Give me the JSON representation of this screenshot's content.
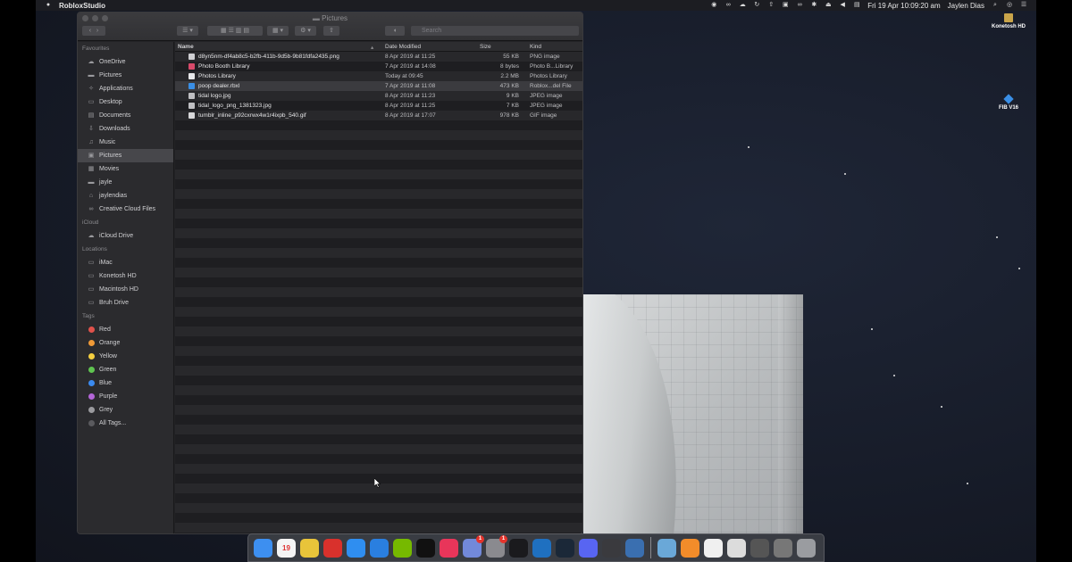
{
  "menubar": {
    "apple": "",
    "app_name": "RobloxStudio",
    "date_time": "Fri 19 Apr  10:09:20 am",
    "user": "Jaylen Dias"
  },
  "desktop": {
    "icons": [
      {
        "label": "Konetosh HD"
      },
      {
        "label": "FIB V16"
      }
    ]
  },
  "finder": {
    "title": "Pictures",
    "search_placeholder": "Search",
    "sidebar": {
      "favourites_header": "Favourites",
      "favourites": [
        {
          "label": "OneDrive",
          "icon": "cloud-icon"
        },
        {
          "label": "Pictures",
          "icon": "folder-icon"
        },
        {
          "label": "Applications",
          "icon": "applications-icon"
        },
        {
          "label": "Desktop",
          "icon": "desktop-icon"
        },
        {
          "label": "Documents",
          "icon": "documents-icon"
        },
        {
          "label": "Downloads",
          "icon": "downloads-icon"
        },
        {
          "label": "Music",
          "icon": "music-icon"
        },
        {
          "label": "Pictures",
          "icon": "pictures-icon",
          "selected": true
        },
        {
          "label": "Movies",
          "icon": "movies-icon"
        },
        {
          "label": "jayle",
          "icon": "folder-icon"
        },
        {
          "label": "jaylendias",
          "icon": "home-icon"
        },
        {
          "label": "Creative Cloud Files",
          "icon": "creative-cloud-icon"
        }
      ],
      "icloud_header": "iCloud",
      "icloud": [
        {
          "label": "iCloud Drive",
          "icon": "icloud-icon"
        }
      ],
      "locations_header": "Locations",
      "locations": [
        {
          "label": "iMac",
          "icon": "computer-icon"
        },
        {
          "label": "Konetosh HD",
          "icon": "drive-icon"
        },
        {
          "label": "Macintosh HD",
          "icon": "drive-icon"
        },
        {
          "label": "Bruh Drive",
          "icon": "drive-icon"
        }
      ],
      "tags_header": "Tags",
      "tags": [
        {
          "label": "Red",
          "color": "#e0524b"
        },
        {
          "label": "Orange",
          "color": "#f09a37"
        },
        {
          "label": "Yellow",
          "color": "#f5cf40"
        },
        {
          "label": "Green",
          "color": "#5fc450"
        },
        {
          "label": "Blue",
          "color": "#3b8bf0"
        },
        {
          "label": "Purple",
          "color": "#b466d8"
        },
        {
          "label": "Grey",
          "color": "#9a9a9e"
        },
        {
          "label": "All Tags...",
          "color": "#5a5a5e"
        }
      ]
    },
    "columns": {
      "name": "Name",
      "date": "Date Modified",
      "size": "Size",
      "kind": "Kind"
    },
    "files": [
      {
        "name": "d8yn5nm-df4ab8c5-b2fb-411b-9d5b-9b81fdfa2435.png",
        "date": "8 Apr 2019 at 11:25",
        "size": "55 KB",
        "kind": "PNG image"
      },
      {
        "name": "Photo Booth Library",
        "date": "7 Apr 2019 at 14:08",
        "size": "8 bytes",
        "kind": "Photo B...Library"
      },
      {
        "name": "Photos Library",
        "date": "Today at 09:45",
        "size": "2.2 MB",
        "kind": "Photos Library"
      },
      {
        "name": "poop dealer.rbxl",
        "date": "7 Apr 2019 at 11:08",
        "size": "473 KB",
        "kind": "Roblox...del File",
        "highlighted": true
      },
      {
        "name": "tidal logo.jpg",
        "date": "8 Apr 2019 at 11:23",
        "size": "9 KB",
        "kind": "JPEG image"
      },
      {
        "name": "tidal_logo_png_1381323.jpg",
        "date": "8 Apr 2019 at 11:25",
        "size": "7 KB",
        "kind": "JPEG image"
      },
      {
        "name": "tumblr_inline_p92cxrwx4w1r4ixpb_540.gif",
        "date": "8 Apr 2019 at 17:07",
        "size": "978 KB",
        "kind": "GIF image"
      }
    ]
  },
  "dock": {
    "apps": [
      {
        "name": "finder-icon",
        "color": "#3d8ff0"
      },
      {
        "name": "calendar-icon",
        "color": "#f4f4f4",
        "text": "19"
      },
      {
        "name": "chrome-icon",
        "color": "#e8c43a"
      },
      {
        "name": "creative-cloud-icon",
        "color": "#d9312c"
      },
      {
        "name": "app-store-icon",
        "color": "#2f8ef0"
      },
      {
        "name": "xcode-icon",
        "color": "#2a7fe0"
      },
      {
        "name": "nvidia-icon",
        "color": "#76b900"
      },
      {
        "name": "tidal-icon",
        "color": "#111111"
      },
      {
        "name": "shape-app-icon",
        "color": "#e8355a"
      },
      {
        "name": "discord-icon",
        "color": "#7289da",
        "badge": "1"
      },
      {
        "name": "system-preferences-icon",
        "color": "#8a8a8f",
        "badge": "1"
      },
      {
        "name": "quicktime-icon",
        "color": "#1a1a1d"
      },
      {
        "name": "trello-icon",
        "color": "#1f70c0"
      },
      {
        "name": "steam-icon",
        "color": "#1b2838"
      },
      {
        "name": "discord-canary-icon",
        "color": "#5865f2"
      },
      {
        "name": "audio-app-icon",
        "color": "#3a3a3e"
      },
      {
        "name": "roblox-studio-icon",
        "color": "#3a6fb0"
      }
    ],
    "docs": [
      {
        "name": "folder-icon",
        "color": "#6aa8d8"
      },
      {
        "name": "pages-icon",
        "color": "#f28c2a"
      },
      {
        "name": "document-icon",
        "color": "#f0f0f0"
      },
      {
        "name": "window-thumbnail-icon",
        "color": "#dcdcdc"
      },
      {
        "name": "window-thumbnail-icon",
        "color": "#555"
      },
      {
        "name": "window-thumbnail-icon",
        "color": "#777"
      },
      {
        "name": "trash-icon",
        "color": "#9a9ca0"
      }
    ]
  }
}
